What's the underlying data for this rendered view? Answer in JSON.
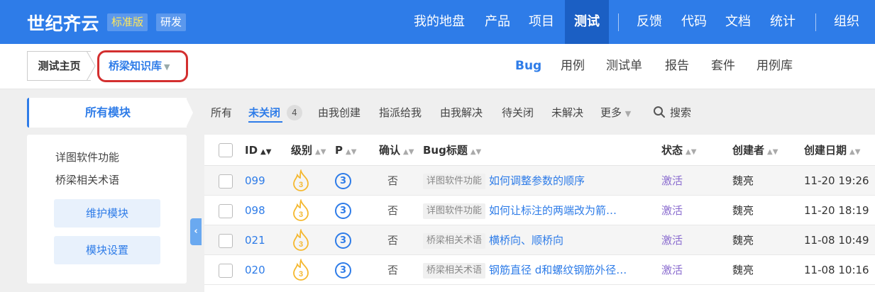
{
  "header": {
    "brand": "世纪齐云",
    "edition": "标准版",
    "team": "研发",
    "nav": [
      {
        "label": "我的地盘",
        "active": false
      },
      {
        "label": "产品",
        "active": false
      },
      {
        "label": "项目",
        "active": false
      },
      {
        "label": "测试",
        "active": true
      },
      {
        "label": "反馈",
        "active": false
      },
      {
        "label": "代码",
        "active": false
      },
      {
        "label": "文档",
        "active": false
      },
      {
        "label": "统计",
        "active": false
      },
      {
        "label": "组织",
        "active": false
      }
    ]
  },
  "breadcrumb": {
    "home": "测试主页",
    "library": "桥梁知识库"
  },
  "subtabs": [
    {
      "label": "Bug",
      "active": true
    },
    {
      "label": "用例",
      "active": false
    },
    {
      "label": "测试单",
      "active": false
    },
    {
      "label": "报告",
      "active": false
    },
    {
      "label": "套件",
      "active": false
    },
    {
      "label": "用例库",
      "active": false
    }
  ],
  "sidebar": {
    "header": "所有模块",
    "modules": [
      "详图软件功能",
      "桥梁相关术语"
    ],
    "maintain_button": "维护模块",
    "settings_button": "模块设置"
  },
  "filters": {
    "all": "所有",
    "unclosed": "未关闭",
    "unclosed_count": "4",
    "created_by_me": "由我创建",
    "assigned_to_me": "指派给我",
    "resolved_by_me": "由我解决",
    "to_close": "待关闭",
    "unresolved": "未解决",
    "more": "更多",
    "search": "搜索"
  },
  "table": {
    "columns": {
      "id": "ID",
      "severity": "级别",
      "priority": "P",
      "confirmed": "确认",
      "title": "Bug标题",
      "status": "状态",
      "creator": "创建者",
      "date": "创建日期"
    },
    "rows": [
      {
        "id": "099",
        "severity": "3",
        "priority": "3",
        "confirmed": "否",
        "module": "详图软件功能",
        "title": "如何调整参数的顺序",
        "status": "激活",
        "creator": "魏亮",
        "date": "11-20 19:26"
      },
      {
        "id": "098",
        "severity": "3",
        "priority": "3",
        "confirmed": "否",
        "module": "详图软件功能",
        "title": "如何让标注的两端改为箭…",
        "status": "激活",
        "creator": "魏亮",
        "date": "11-20 18:19"
      },
      {
        "id": "021",
        "severity": "3",
        "priority": "3",
        "confirmed": "否",
        "module": "桥梁相关术语",
        "title": "横桥向、顺桥向",
        "status": "激活",
        "creator": "魏亮",
        "date": "11-08 10:49"
      },
      {
        "id": "020",
        "severity": "3",
        "priority": "3",
        "confirmed": "否",
        "module": "桥梁相关术语",
        "title": "钢筋直径 d和螺纹钢筋外径…",
        "status": "激活",
        "creator": "魏亮",
        "date": "11-08 10:16"
      }
    ]
  },
  "colors": {
    "primary": "#2e7ce8",
    "header_active": "#1b5fc4",
    "status_active": "#8a6ccf",
    "severity_flame": "#f5b82e",
    "highlight_ring": "#d32f2f"
  }
}
